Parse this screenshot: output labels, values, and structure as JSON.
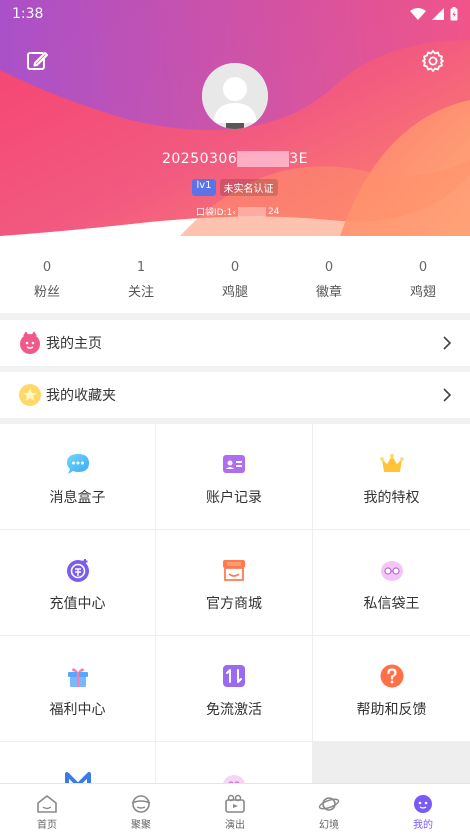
{
  "status": {
    "time": "1:38"
  },
  "profile": {
    "username_prefix": "20250306",
    "username_suffix": "3E",
    "level": "lv1",
    "verify_status": "未实名认证",
    "kd_id_label": "口袋ID:1‹",
    "kd_id_suffix": "24"
  },
  "stats": [
    {
      "value": "0",
      "label": "粉丝"
    },
    {
      "value": "1",
      "label": "关注"
    },
    {
      "value": "0",
      "label": "鸡腿"
    },
    {
      "value": "0",
      "label": "徽章"
    },
    {
      "value": "0",
      "label": "鸡翅"
    }
  ],
  "links": {
    "homepage": "我的主页",
    "favorites": "我的收藏夹"
  },
  "grid": [
    {
      "label": "消息盒子",
      "icon": "message-icon"
    },
    {
      "label": "账户记录",
      "icon": "account-card-icon"
    },
    {
      "label": "我的特权",
      "icon": "crown-icon"
    },
    {
      "label": "充值中心",
      "icon": "recharge-icon"
    },
    {
      "label": "官方商城",
      "icon": "shop-icon"
    },
    {
      "label": "私信袋王",
      "icon": "dm-king-icon"
    },
    {
      "label": "福利中心",
      "icon": "gift-icon"
    },
    {
      "label": "免流激活",
      "icon": "data-free-icon"
    },
    {
      "label": "帮助和反馈",
      "icon": "help-icon"
    }
  ],
  "tabs": [
    {
      "label": "首页",
      "icon": "home-icon"
    },
    {
      "label": "聚聚",
      "icon": "juju-icon"
    },
    {
      "label": "演出",
      "icon": "show-icon"
    },
    {
      "label": "幻境",
      "icon": "planet-icon"
    },
    {
      "label": "我的",
      "icon": "me-icon"
    }
  ],
  "colors": {
    "accent": "#7a5af5",
    "brand_pink": "#f24a7a",
    "brand_orange": "#ff9a6a"
  }
}
